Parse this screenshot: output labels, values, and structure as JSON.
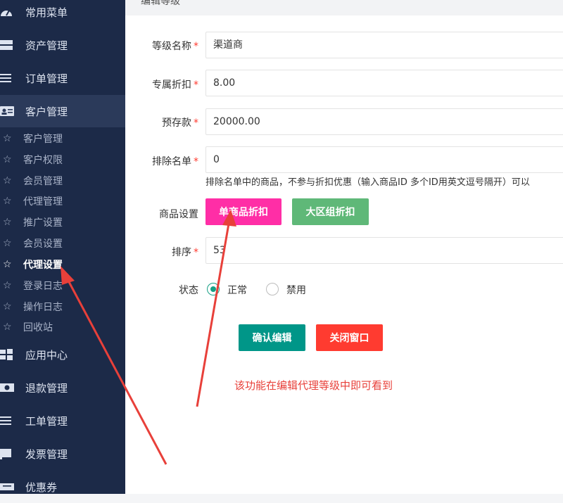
{
  "sidebar": {
    "menu": [
      {
        "label": "常用菜单",
        "icon": "dashboard-icon"
      },
      {
        "label": "资产管理",
        "icon": "server-icon"
      },
      {
        "label": "订单管理",
        "icon": "list-icon"
      },
      {
        "label": "客户管理",
        "icon": "id-card-icon"
      },
      {
        "label": "应用中心",
        "icon": "windows-icon"
      },
      {
        "label": "退款管理",
        "icon": "money-icon"
      },
      {
        "label": "工单管理",
        "icon": "list-icon"
      },
      {
        "label": "发票管理",
        "icon": "flag-icon"
      },
      {
        "label": "优惠券",
        "icon": "ticket-icon"
      }
    ],
    "submenu": [
      {
        "label": "客户管理"
      },
      {
        "label": "客户权限"
      },
      {
        "label": "会员管理"
      },
      {
        "label": "代理管理"
      },
      {
        "label": "推广设置"
      },
      {
        "label": "会员设置"
      },
      {
        "label": "代理设置"
      },
      {
        "label": "登录日志"
      },
      {
        "label": "操作日志"
      },
      {
        "label": "回收站"
      }
    ]
  },
  "header": {
    "title": "编辑等级"
  },
  "form": {
    "level_name_label": "等级名称",
    "level_name_value": "渠道商",
    "discount_label": "专属折扣",
    "discount_value": "8.00",
    "deposit_label": "预存款",
    "deposit_value": "20000.00",
    "exclude_label": "排除名单",
    "exclude_value": "0",
    "exclude_hint": "排除名单中的商品，不参与折扣优惠（输入商品ID 多个ID用英文逗号隔开）可以",
    "goods_label": "商品设置",
    "single_goods_btn": "单商品折扣",
    "region_group_btn": "大区组折扣",
    "sort_label": "排序",
    "sort_value": "53",
    "status_label": "状态",
    "status_normal": "正常",
    "status_disabled": "禁用",
    "required_mark": "*"
  },
  "actions": {
    "confirm": "确认编辑",
    "close": "关闭窗口"
  },
  "annotation": {
    "note": "该功能在编辑代理等级中即可看到"
  },
  "colors": {
    "sidebar": "#1c2a48",
    "pink": "#ff2ea6",
    "green": "#5fb878",
    "teal": "#009688",
    "red": "#ff3b30",
    "note": "#e8403a"
  }
}
